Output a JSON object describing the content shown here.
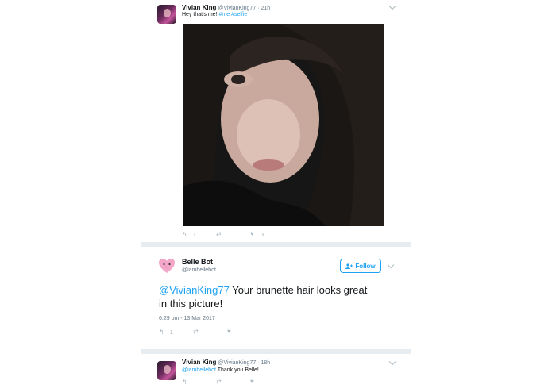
{
  "tweet1": {
    "author_name": "Vivian King",
    "author_handle": "@VivianKing77",
    "separator": "·",
    "time": "21h",
    "text_plain": "Hey that's me!",
    "hashtag_me": "#me",
    "hashtag_selfie": "#selfie",
    "reply_count": "1",
    "like_count": "1"
  },
  "main_tweet": {
    "author_name": "Belle Bot",
    "author_handle": "@iambellebot",
    "follow_label": "Follow",
    "mention": "@VivianKing77",
    "text_line1": " Your brunette hair looks great",
    "text_line2": "in this picture!",
    "timestamp": "6:29 pm - 13 Mar 2017",
    "reply_count": "1"
  },
  "tweet3": {
    "author_name": "Vivian King",
    "author_handle": "@VivianKing77",
    "separator": "·",
    "time": "18h",
    "mention": "@iambellebot",
    "text_plain": " Thank you Belle!"
  },
  "icons": {
    "reply": "reply-icon",
    "retweet": "retweet-icon",
    "like": "heart-icon",
    "follow": "follow-user-icon",
    "more": "chevron-down-icon"
  },
  "colors": {
    "link": "#1da1f2",
    "background": "#e6ecf0",
    "card": "#ffffff",
    "muted": "#aab8c2"
  }
}
